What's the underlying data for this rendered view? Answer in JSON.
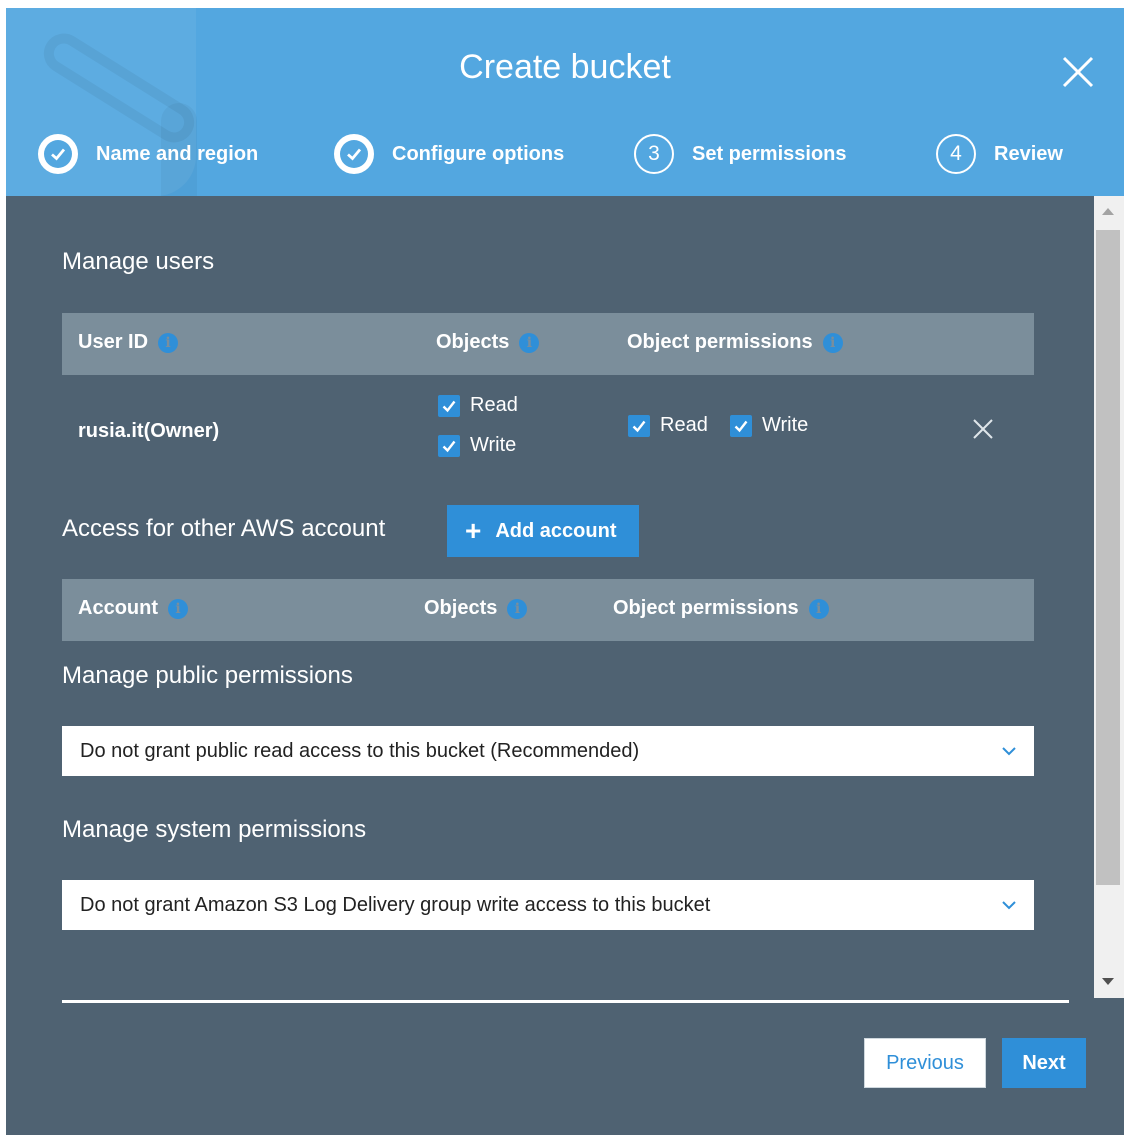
{
  "dialog": {
    "title": "Create bucket",
    "close_icon": "close-icon"
  },
  "steps": [
    {
      "label": "Name and region",
      "status": "done",
      "icon": "check-icon"
    },
    {
      "label": "Configure options",
      "status": "done",
      "icon": "check-icon"
    },
    {
      "label": "Set permissions",
      "status": "current",
      "number": "3"
    },
    {
      "label": "Review",
      "status": "pending",
      "number": "4"
    }
  ],
  "manage_users": {
    "heading": "Manage users",
    "headers": {
      "user_id": "User ID",
      "objects": "Objects",
      "object_permissions": "Object permissions"
    },
    "rows": [
      {
        "user": "rusia.it(Owner)",
        "objects": {
          "read_label": "Read",
          "read": true,
          "write_label": "Write",
          "write": true
        },
        "object_permissions": {
          "read_label": "Read",
          "read": true,
          "write_label": "Write",
          "write": true
        }
      }
    ]
  },
  "other_accounts": {
    "heading": "Access for other AWS account",
    "add_button": "Add account",
    "headers": {
      "account": "Account",
      "objects": "Objects",
      "object_permissions": "Object permissions"
    }
  },
  "public_permissions": {
    "heading": "Manage public permissions",
    "selected": "Do not grant public read access to this bucket (Recommended)"
  },
  "system_permissions": {
    "heading": "Manage system permissions",
    "selected": "Do not grant Amazon S3 Log Delivery group write access to this bucket"
  },
  "footer": {
    "previous": "Previous",
    "next": "Next"
  },
  "colors": {
    "header_bg": "#53a7e0",
    "body_bg": "#4f6272",
    "table_header_bg": "#7b8e9b",
    "accent": "#2f8fd8"
  }
}
